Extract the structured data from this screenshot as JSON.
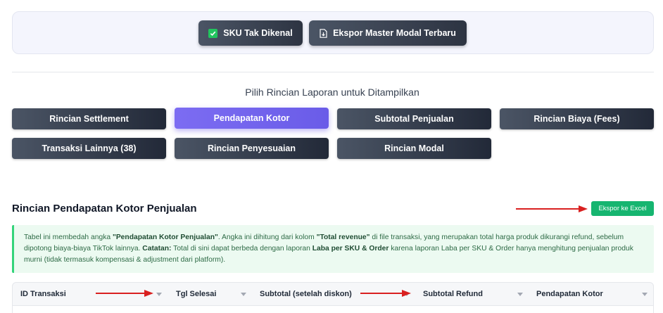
{
  "top_panel": {
    "sku_button": "SKU Tak Dikenal",
    "ekspor_button": "Ekspor Master Modal Terbaru"
  },
  "report_selector": {
    "title": "Pilih Rincian Laporan untuk Ditampilkan",
    "buttons": [
      {
        "label": "Rincian Settlement",
        "active": false
      },
      {
        "label": "Pendapatan Kotor",
        "active": true
      },
      {
        "label": "Subtotal Penjualan",
        "active": false
      },
      {
        "label": "Rincian Biaya (Fees)",
        "active": false
      },
      {
        "label": "Transaksi Lainnya (38)",
        "active": false
      },
      {
        "label": "Rincian Penyesuaian",
        "active": false
      },
      {
        "label": "Rincian Modal",
        "active": false
      }
    ]
  },
  "section": {
    "title": "Rincian Pendapatan Kotor Penjualan",
    "export_button": "Ekspor ke Excel"
  },
  "info": {
    "p1": "Tabel ini membedah angka ",
    "b1": "\"Pendapatan Kotor Penjualan\"",
    "p2": ". Angka ini dihitung dari kolom ",
    "b2": "\"Total revenue\"",
    "p3": " di file transaksi, yang merupakan total harga produk dikurangi refund, sebelum dipotong biaya-biaya TikTok lainnya. ",
    "b3": "Catatan:",
    "p4": " Total di sini dapat berbeda dengan laporan ",
    "b4": "Laba per SKU & Order",
    "p5": " karena laporan Laba per SKU & Order hanya menghitung penjualan produk murni (tidak termasuk kompensasi & adjustment dari platform)."
  },
  "table": {
    "columns": [
      "ID Transaksi",
      "Tgl Selesai",
      "Subtotal (setelah diskon)",
      "Subtotal Refund",
      "Pendapatan Kotor"
    ]
  },
  "colors": {
    "accent": "#6a5ce8",
    "excel": "#16b570",
    "annotation_arrow": "#d92020"
  }
}
